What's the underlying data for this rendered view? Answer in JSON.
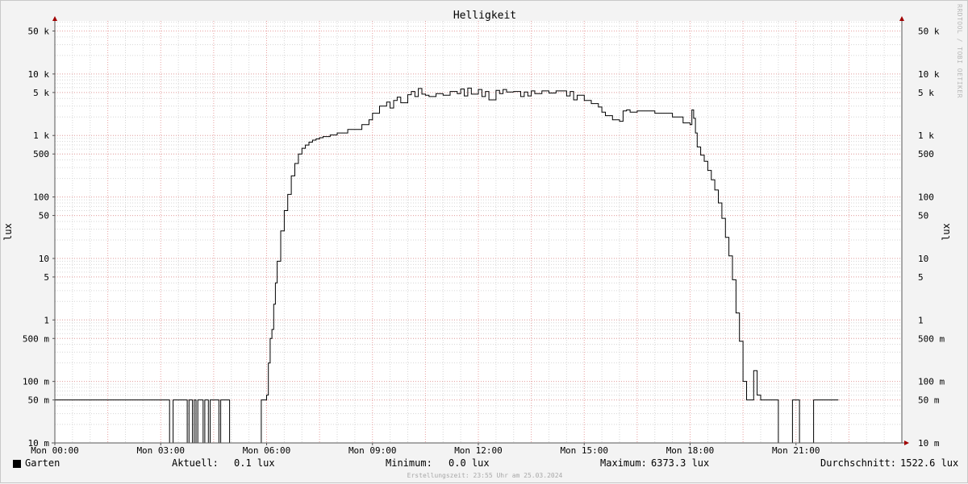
{
  "chart_data": {
    "type": "line",
    "title": "Helligkeit",
    "ylabel": "lux",
    "ylabel_right": "lux",
    "yscale": "log",
    "ylim": [
      0.01,
      100000
    ],
    "xlim_hours": [
      0,
      24
    ],
    "x_ticks": [
      {
        "hour": 0,
        "label": "Mon 00:00"
      },
      {
        "hour": 3,
        "label": "Mon 03:00"
      },
      {
        "hour": 6,
        "label": "Mon 06:00"
      },
      {
        "hour": 9,
        "label": "Mon 09:00"
      },
      {
        "hour": 12,
        "label": "Mon 12:00"
      },
      {
        "hour": 15,
        "label": "Mon 15:00"
      },
      {
        "hour": 18,
        "label": "Mon 18:00"
      },
      {
        "hour": 21,
        "label": "Mon 21:00"
      }
    ],
    "y_ticks": [
      {
        "value": 0.01,
        "label": "10 m"
      },
      {
        "value": 0.05,
        "label": "50 m"
      },
      {
        "value": 0.1,
        "label": "100 m"
      },
      {
        "value": 0.5,
        "label": "500 m"
      },
      {
        "value": 1,
        "label": "1"
      },
      {
        "value": 5,
        "label": "5"
      },
      {
        "value": 10,
        "label": "10"
      },
      {
        "value": 50,
        "label": "50"
      },
      {
        "value": 100,
        "label": "100"
      },
      {
        "value": 500,
        "label": "500"
      },
      {
        "value": 1000,
        "label": "1 k"
      },
      {
        "value": 5000,
        "label": "5 k"
      },
      {
        "value": 10000,
        "label": "10 k"
      },
      {
        "value": 50000,
        "label": "50 k"
      }
    ],
    "series": [
      {
        "name": "Garten",
        "color": "#000000",
        "x_hours": [
          0,
          3.2,
          3.25,
          3.35,
          3.7,
          3.75,
          3.8,
          3.9,
          3.95,
          4.0,
          4.05,
          4.1,
          4.2,
          4.25,
          4.35,
          4.4,
          4.6,
          4.65,
          4.7,
          4.9,
          4.95,
          5.2,
          5.8,
          5.85,
          6.0,
          6.05,
          6.1,
          6.15,
          6.2,
          6.25,
          6.3,
          6.4,
          6.5,
          6.6,
          6.7,
          6.8,
          6.9,
          7.0,
          7.1,
          7.2,
          7.3,
          7.4,
          7.5,
          7.6,
          7.8,
          8.0,
          8.3,
          8.7,
          8.9,
          9.0,
          9.2,
          9.4,
          9.5,
          9.6,
          9.7,
          9.8,
          10.0,
          10.1,
          10.2,
          10.3,
          10.4,
          10.5,
          10.6,
          10.8,
          11.0,
          11.2,
          11.4,
          11.5,
          11.6,
          11.7,
          11.8,
          12.0,
          12.1,
          12.2,
          12.3,
          12.5,
          12.6,
          12.7,
          12.8,
          13.0,
          13.2,
          13.3,
          13.4,
          13.5,
          13.6,
          13.8,
          14.0,
          14.2,
          14.5,
          14.6,
          14.7,
          14.8,
          15.0,
          15.2,
          15.4,
          15.5,
          15.6,
          15.8,
          16.0,
          16.1,
          16.2,
          16.3,
          16.5,
          17.0,
          17.5,
          17.8,
          18.0,
          18.05,
          18.1,
          18.15,
          18.2,
          18.3,
          18.4,
          18.5,
          18.6,
          18.7,
          18.8,
          18.9,
          19.0,
          19.1,
          19.2,
          19.3,
          19.4,
          19.5,
          19.6,
          19.7,
          19.8,
          19.9,
          20.0,
          20.1,
          20.3,
          20.4,
          20.5,
          20.9,
          20.95,
          21.1,
          21.2,
          21.25,
          21.4,
          21.5,
          22.1,
          22.2,
          24.0
        ],
        "values": [
          0.05,
          0.05,
          0.01,
          0.05,
          0.05,
          0.01,
          0.05,
          0.01,
          0.05,
          0.01,
          0.05,
          0.05,
          0.01,
          0.05,
          0.01,
          0.05,
          0.05,
          0.01,
          0.05,
          0.05,
          0.01,
          0.01,
          0.01,
          0.05,
          0.06,
          0.2,
          0.5,
          0.7,
          1.8,
          4.0,
          9.0,
          28,
          60,
          110,
          220,
          350,
          500,
          620,
          700,
          780,
          840,
          880,
          920,
          960,
          1020,
          1100,
          1250,
          1500,
          1800,
          2300,
          3000,
          3500,
          2800,
          3700,
          4200,
          3400,
          4600,
          5200,
          4300,
          5800,
          4700,
          4500,
          4300,
          4800,
          4500,
          5200,
          4800,
          5700,
          4400,
          5900,
          4700,
          5600,
          4300,
          5200,
          3800,
          5400,
          4800,
          5600,
          5100,
          5200,
          4300,
          5100,
          4400,
          5300,
          4800,
          5300,
          4900,
          5300,
          4400,
          5200,
          3800,
          4500,
          3700,
          3300,
          2900,
          2400,
          2100,
          1800,
          1700,
          2500,
          2600,
          2400,
          2500,
          2300,
          2000,
          1600,
          1500,
          2600,
          1900,
          1100,
          650,
          480,
          380,
          270,
          190,
          130,
          80,
          45,
          22,
          11,
          4.5,
          1.3,
          0.45,
          0.1,
          0.05,
          0.05,
          0.15,
          0.06,
          0.05,
          0.05,
          0.05,
          0.05,
          0.01,
          0.05,
          0.05,
          0.01,
          0.01,
          0.01,
          0.01,
          0.05,
          0.05
        ]
      }
    ],
    "grid": true,
    "legend": "bottom-left"
  },
  "legend": {
    "series_label": "Garten",
    "current_label": "Aktuell:",
    "current_value": "0.1 lux",
    "min_label": "Minimum:",
    "min_value": "0.0 lux",
    "max_label": "Maximum:",
    "max_value": "6373.3 lux",
    "avg_label": "Durchschnitt:",
    "avg_value": "1522.6 lux"
  },
  "credit": "Erstellungszeit: 23:55 Uhr am 25.03.2024",
  "watermark": "RRDTOOL / TOBI OETIKER"
}
